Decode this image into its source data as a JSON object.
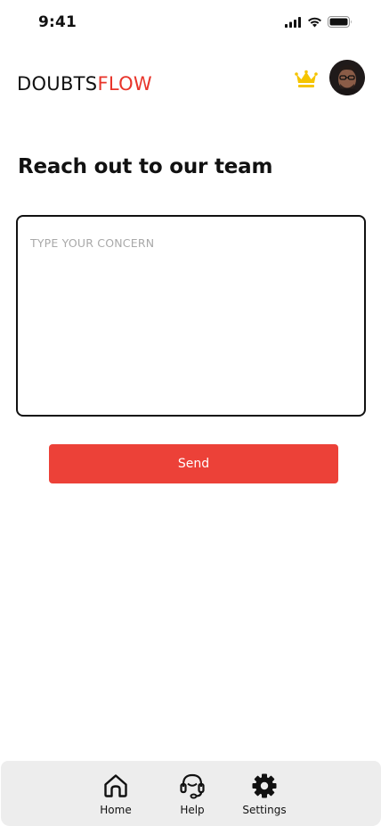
{
  "status_bar": {
    "time": "9:41"
  },
  "header": {
    "brand_part1": "DOUBTS",
    "brand_part2": "FLOW",
    "brand_color": "#e8352b",
    "crown_icon": "crown-icon",
    "crown_color": "#f5c400"
  },
  "main": {
    "title": "Reach out to our team",
    "concern_placeholder": "TYPE YOUR CONCERN",
    "concern_value": "",
    "send_label": "Send",
    "send_color": "#ec4138"
  },
  "bottom_nav": {
    "items": [
      {
        "label": "Home",
        "icon": "home-icon"
      },
      {
        "label": "Help",
        "icon": "headset-icon"
      },
      {
        "label": "Settings",
        "icon": "gear-icon"
      }
    ]
  }
}
